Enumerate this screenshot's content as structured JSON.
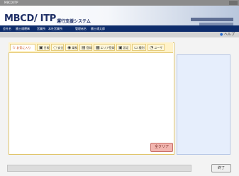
{
  "window": {
    "title": "MBCD/ITP"
  },
  "header": {
    "logo": "MBCD/ ITP",
    "subtitle": "運行支援システム"
  },
  "info": {
    "company": "会社名",
    "company_value": "國土通運㈱",
    "office": "営業所",
    "office_value": "本社営業所",
    "operator": "管理者名",
    "operator_value": "國土通太郎"
  },
  "help": {
    "label": "ヘルプ"
  },
  "tabs": [
    {
      "label": "お気に入り",
      "icon": "star-icon"
    },
    {
      "label": "日報",
      "icon": "note-icon"
    },
    {
      "label": "安全",
      "icon": "shield-icon"
    },
    {
      "label": "乗務",
      "icon": "person-icon"
    },
    {
      "label": "登録",
      "icon": "folder-icon"
    },
    {
      "label": "エリア登録",
      "icon": "map-icon"
    },
    {
      "label": "設定",
      "icon": "gear-icon"
    },
    {
      "label": "種別",
      "icon": "tag-icon"
    },
    {
      "label": "ユーザ",
      "icon": "user-icon"
    }
  ],
  "actions": {
    "clear": "全クリア",
    "close": "終了"
  }
}
